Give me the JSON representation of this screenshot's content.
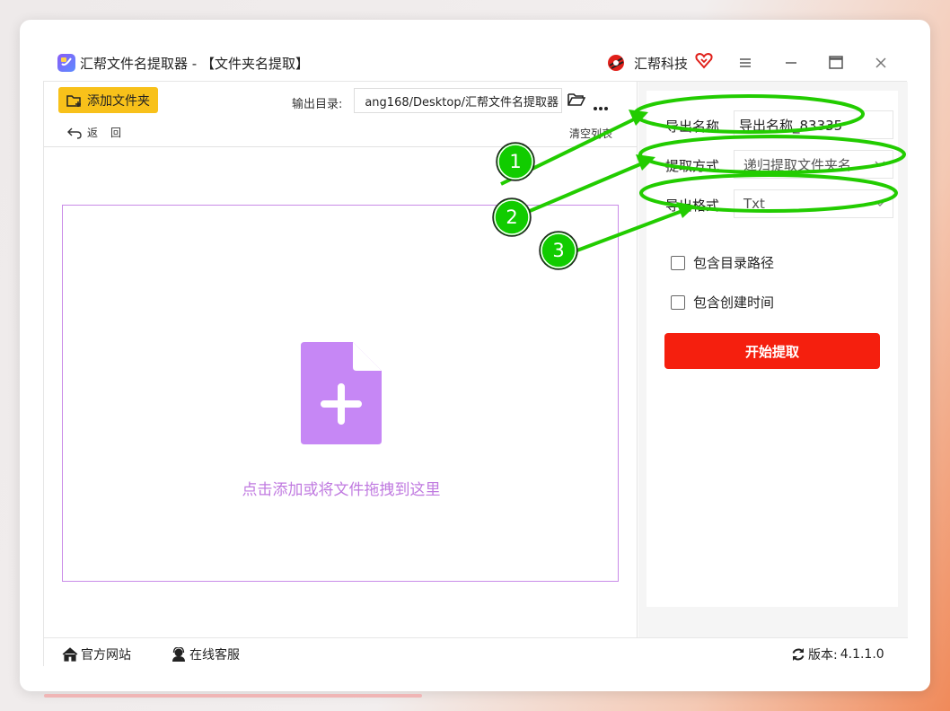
{
  "window": {
    "title": "汇帮文件名提取器 - 【文件夹名提取】",
    "brand": "汇帮科技"
  },
  "toolbar": {
    "add_folder_label": "添加文件夹",
    "output_dir_label": "输出目录:",
    "output_dir_value": "ang168/Desktop/汇帮文件名提取器",
    "back_label": "返回",
    "clear_list_label": "清空列表"
  },
  "dropzone": {
    "hint": "点击添加或将文件拖拽到这里"
  },
  "settings": {
    "export_name_label": "导出名称",
    "export_name_value": "导出名称_83335",
    "extract_mode_label": "提取方式",
    "extract_mode_value": "递归提取文件夹名",
    "export_format_label": "导出格式",
    "export_format_value": "Txt",
    "include_dir_path_label": "包含目录路径",
    "include_dir_path_checked": false,
    "include_create_time_label": "包含创建时间",
    "include_create_time_checked": false,
    "start_label": "开始提取"
  },
  "statusbar": {
    "website_label": "官方网站",
    "support_label": "在线客服",
    "version_label": "版本:",
    "version_value": "4.1.1.0"
  },
  "annotations": {
    "color": "#22cc00",
    "steps": [
      "1",
      "2",
      "3"
    ]
  },
  "colors": {
    "accent_yellow": "#f8c11a",
    "start_red": "#f51f0e",
    "dropzone_purple": "#c98be8",
    "doc_icon_purple": "#c687f5"
  }
}
